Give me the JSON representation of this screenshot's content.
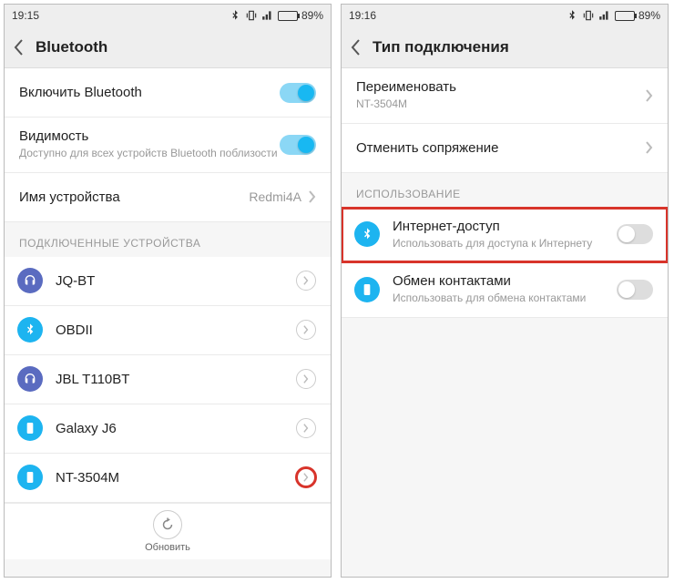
{
  "left": {
    "status": {
      "time": "19:15",
      "battery": "89%"
    },
    "title": "Bluetooth",
    "enable": {
      "label": "Включить Bluetooth",
      "on": true
    },
    "visibility": {
      "label": "Видимость",
      "sub": "Доступно для всех устройств Bluetooth поблизости",
      "on": true
    },
    "deviceName": {
      "label": "Имя устройства",
      "value": "Redmi4A"
    },
    "sectionConnected": "ПОДКЛЮЧЕННЫЕ УСТРОЙСТВА",
    "devices": [
      {
        "name": "JQ-BT",
        "icon": "headset"
      },
      {
        "name": "OBDII",
        "icon": "bt"
      },
      {
        "name": "JBL T110BT",
        "icon": "headset"
      },
      {
        "name": "Galaxy J6",
        "icon": "phone"
      },
      {
        "name": "NT-3504M",
        "icon": "phone",
        "highlight": true
      }
    ],
    "refresh": "Обновить"
  },
  "right": {
    "status": {
      "time": "19:16",
      "battery": "89%"
    },
    "title": "Тип подключения",
    "rename": {
      "label": "Переименовать",
      "value": "NT-3504M"
    },
    "unpair": {
      "label": "Отменить сопряжение"
    },
    "sectionUsage": "ИСПОЛЬЗОВАНИЕ",
    "internet": {
      "label": "Интернет-доступ",
      "sub": "Использовать для доступа к Интернету",
      "on": false,
      "highlight": true
    },
    "contacts": {
      "label": "Обмен контактами",
      "sub": "Использовать для обмена контактами",
      "on": false
    }
  }
}
